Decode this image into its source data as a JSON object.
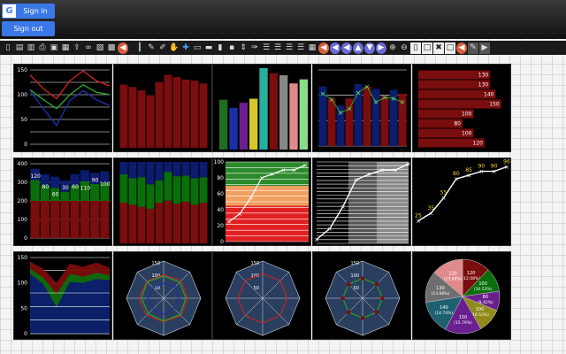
{
  "auth": {
    "sign_in_label": "Sign in",
    "sign_out_label": "Sign out",
    "google_glyph": "G"
  },
  "toolbar_icons": [
    "new-doc-icon",
    "open-doc-icon",
    "delete-doc-icon",
    "print-icon",
    "save-icon",
    "save-as-icon",
    "export-icon",
    "link-icon",
    "image-icon",
    "photo-icon",
    "settings-icon",
    "separator",
    "cursor-icon",
    "pen-icon",
    "brush-icon",
    "hand-icon",
    "add-icon",
    "frame-icon",
    "minus-icon",
    "chart-icon",
    "data-icon",
    "arrows-icon",
    "edit-icon",
    "align-left-icon",
    "align-center-icon",
    "align-right-icon",
    "align-justify-icon",
    "delete-icon",
    "settings-icon",
    "back-icon",
    "prev-icon",
    "up-icon",
    "down-icon",
    "forward-icon",
    "zoom-in-icon",
    "zoom-out-icon",
    "clear-icon",
    "blank-icon",
    "remove-icon",
    "square-icon",
    "settings-icon",
    "edit-window-icon",
    "play-icon"
  ],
  "colors": {
    "red": "#7a0d0d",
    "blue": "#0c1c6e",
    "green": "#0a6e0a",
    "yellow_label": "#f7d23a",
    "grid": "#ffffff"
  },
  "chart_data": [
    {
      "type": "line",
      "x": [
        1,
        2,
        3,
        4,
        5,
        6,
        7
      ],
      "ylim": [
        0,
        150
      ],
      "yticks": [
        "150",
        "100",
        "50",
        "0"
      ],
      "series": [
        {
          "values": [
            140,
            112,
            92,
            128,
            148,
            128,
            118
          ],
          "color": "#c72222"
        },
        {
          "values": [
            110,
            90,
            72,
            100,
            120,
            105,
            100
          ],
          "color": "#27a327"
        },
        {
          "values": [
            108,
            72,
            38,
            88,
            108,
            90,
            78
          ],
          "color": "#1a2fa8"
        }
      ]
    },
    {
      "type": "bar",
      "values": [
        130,
        125,
        118,
        108,
        135,
        150,
        145,
        140,
        138,
        132
      ],
      "ylim": [
        0,
        160
      ]
    },
    {
      "type": "bar",
      "values": [
        98,
        82,
        92,
        100,
        160,
        150,
        146,
        130,
        138
      ],
      "colors": [
        "#1e6e1e",
        "#1a2fa8",
        "#6a1f8f",
        "#d6c62a",
        "#27b0a0",
        "#7a0d0d",
        "#888888",
        "#e08a8a",
        "#8adb8a"
      ],
      "ylim": [
        0,
        160
      ]
    },
    {
      "type": "bar",
      "values": [
        125,
        100,
        85,
        100,
        130,
        125,
        120,
        105,
        118,
        110
      ],
      "overlay": [
        110,
        98,
        70,
        78,
        112,
        125,
        92,
        102,
        100,
        92
      ],
      "ylim": [
        0,
        160
      ]
    },
    {
      "type": "bar",
      "orientation": "horizontal",
      "values": [
        130,
        130,
        140,
        150,
        100,
        80,
        100,
        120
      ],
      "labels": [
        "130",
        "130",
        "140",
        "150",
        "100",
        "80",
        "100",
        "120"
      ],
      "ylim": [
        0,
        160
      ]
    },
    {
      "type": "bar",
      "stacked": true,
      "values": [
        120,
        80,
        60,
        30,
        80,
        110,
        90,
        100
      ],
      "labels": [
        "120",
        "80",
        "60",
        "30",
        "60",
        "110",
        "90",
        "100"
      ],
      "ylim": [
        0,
        400
      ],
      "yticks": [
        "400",
        "300",
        "200",
        "100",
        "0"
      ]
    },
    {
      "type": "bar",
      "stacked": true,
      "series": [
        {
          "values": [
            200,
            190,
            180,
            170,
            200,
            210,
            195,
            205,
            190,
            200
          ],
          "color": "#7a0d0d"
        },
        {
          "values": [
            140,
            130,
            145,
            120,
            110,
            140,
            135,
            128,
            130,
            125
          ],
          "color": "#0a6e0a"
        },
        {
          "values": [
            60,
            80,
            75,
            110,
            90,
            50,
            70,
            67,
            80,
            75
          ],
          "color": "#0c1c6e"
        }
      ],
      "ylim": [
        0,
        400
      ]
    },
    {
      "type": "line",
      "values": [
        25,
        35,
        55,
        80,
        85,
        90,
        90,
        96
      ],
      "ylim": [
        0,
        100
      ],
      "yticks": [
        "100",
        "80",
        "60",
        "40",
        "20",
        "0"
      ],
      "background": "bands"
    },
    {
      "type": "line",
      "values": [
        5,
        18,
        45,
        78,
        85,
        90,
        90,
        98
      ],
      "ylim": [
        0,
        100
      ],
      "background": "stripes"
    },
    {
      "type": "line",
      "values": [
        25,
        35,
        55,
        80,
        85,
        90,
        90,
        96
      ],
      "labels": [
        "25",
        "35",
        "55",
        "80",
        "85",
        "90",
        "90",
        "96"
      ],
      "ylim": [
        0,
        100
      ]
    },
    {
      "type": "area",
      "yticks": [
        "150",
        "100",
        "50",
        "0"
      ],
      "ylim": [
        0,
        150
      ],
      "series": [
        {
          "values": [
            142,
            128,
            100,
            138,
            132,
            140,
            130
          ],
          "color": "#7a0d0d"
        },
        {
          "values": [
            128,
            110,
            78,
            118,
            112,
            120,
            115
          ],
          "color": "#0a6e0a"
        },
        {
          "values": [
            118,
            98,
            52,
            102,
            100,
            108,
            105
          ],
          "color": "#0c1c6e"
        }
      ]
    },
    {
      "type": "radar",
      "ticks": [
        "150",
        "100",
        "50"
      ],
      "series": [
        {
          "values": [
            95,
            100,
            98,
            100,
            95,
            98,
            100,
            96
          ],
          "color": "#c72222"
        },
        {
          "values": [
            90,
            92,
            90,
            94,
            92,
            88,
            90,
            93
          ],
          "color": "#27a327"
        },
        {
          "values": [
            60,
            65,
            62,
            58,
            64,
            60,
            63,
            60
          ],
          "color": "#1a2fa8"
        }
      ]
    },
    {
      "type": "radar",
      "ticks": [
        "150",
        "100",
        "50"
      ],
      "series": [
        {
          "values": [
            100,
            100,
            100,
            100,
            100,
            100,
            100,
            100
          ],
          "color": "#c72222"
        }
      ]
    },
    {
      "type": "radar",
      "ticks": [
        "150",
        "100",
        "50"
      ],
      "series": [
        {
          "values": [
            80,
            80,
            80,
            80,
            80,
            80,
            80,
            80
          ],
          "color": "#27a327"
        }
      ]
    },
    {
      "type": "pie",
      "slices": [
        {
          "label": "120",
          "pct": "(12.08%)",
          "value": 12.08,
          "color": "#7a0d0d"
        },
        {
          "label": "100",
          "pct": "(10.53%)",
          "value": 10.53,
          "color": "#0a6e0a"
        },
        {
          "label": "80",
          "pct": "(8.42%)",
          "value": 8.42,
          "color": "#6a1f8f"
        },
        {
          "label": "100",
          "pct": "(10.53%)",
          "value": 10.53,
          "color": "#8f8a1a"
        },
        {
          "label": "150",
          "pct": "(15.79%)",
          "value": 15.79,
          "color": "#6a1f8f"
        },
        {
          "label": "140",
          "pct": "(14.74%)",
          "value": 14.74,
          "color": "#1d6070"
        },
        {
          "label": "130",
          "pct": "(13.68%)",
          "value": 13.68,
          "color": "#6e6e6e"
        },
        {
          "label": "130",
          "pct": "(13.68%)",
          "value": 13.68,
          "color": "#e08a8a"
        }
      ]
    }
  ]
}
